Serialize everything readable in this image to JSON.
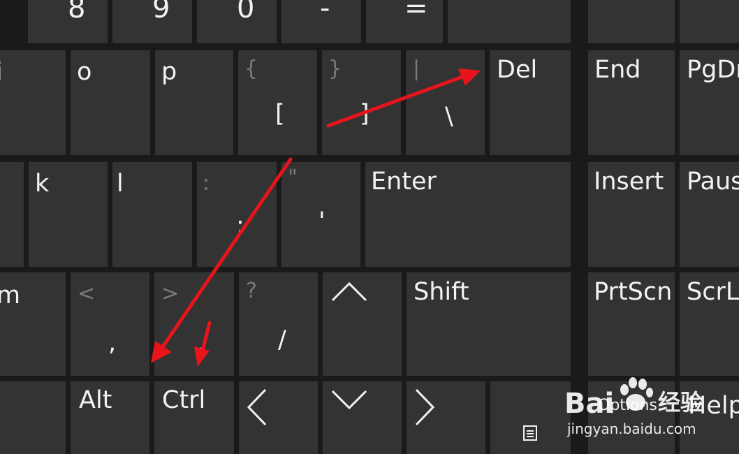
{
  "keyboard": {
    "row_numbers": {
      "k8": "8",
      "k9": "9",
      "k0": "0",
      "minus": "-",
      "equals": "="
    },
    "row_top": {
      "i": "i",
      "o": "o",
      "p": "p",
      "lbrace_shift": "{",
      "lbracket": "[",
      "rbrace_shift": "}",
      "rbracket": "]",
      "pipe_shift": "|",
      "backslash": "\\",
      "del": "Del",
      "end": "End",
      "pgdn": "PgDn"
    },
    "row_home": {
      "k": "k",
      "l": "l",
      "colon_shift": ":",
      "semicolon": ";",
      "quote_shift": "\"",
      "apostrophe": "'",
      "enter": "Enter",
      "insert": "Insert",
      "pause": "Pause"
    },
    "row_bottom": {
      "m": "m",
      "lt_shift": "<",
      "comma": ",",
      "gt_shift": ">",
      "period": ".",
      "question_shift": "?",
      "slash": "/",
      "shift": "Shift",
      "prtscn": "PrtScn",
      "scrlk": "ScrLk"
    },
    "row_space": {
      "alt": "Alt",
      "ctrl": "Ctrl",
      "options": "Options",
      "help": "Help"
    },
    "icons": {
      "up": "arrow-up-icon",
      "left": "arrow-left-icon",
      "down": "arrow-down-icon",
      "right": "arrow-right-icon",
      "fade": "fade-icon"
    }
  },
  "annotation_color": "#e8141c",
  "watermark": {
    "brand": "Bai",
    "brand_cn": "经验",
    "url": "jingyan.baidu.com"
  }
}
